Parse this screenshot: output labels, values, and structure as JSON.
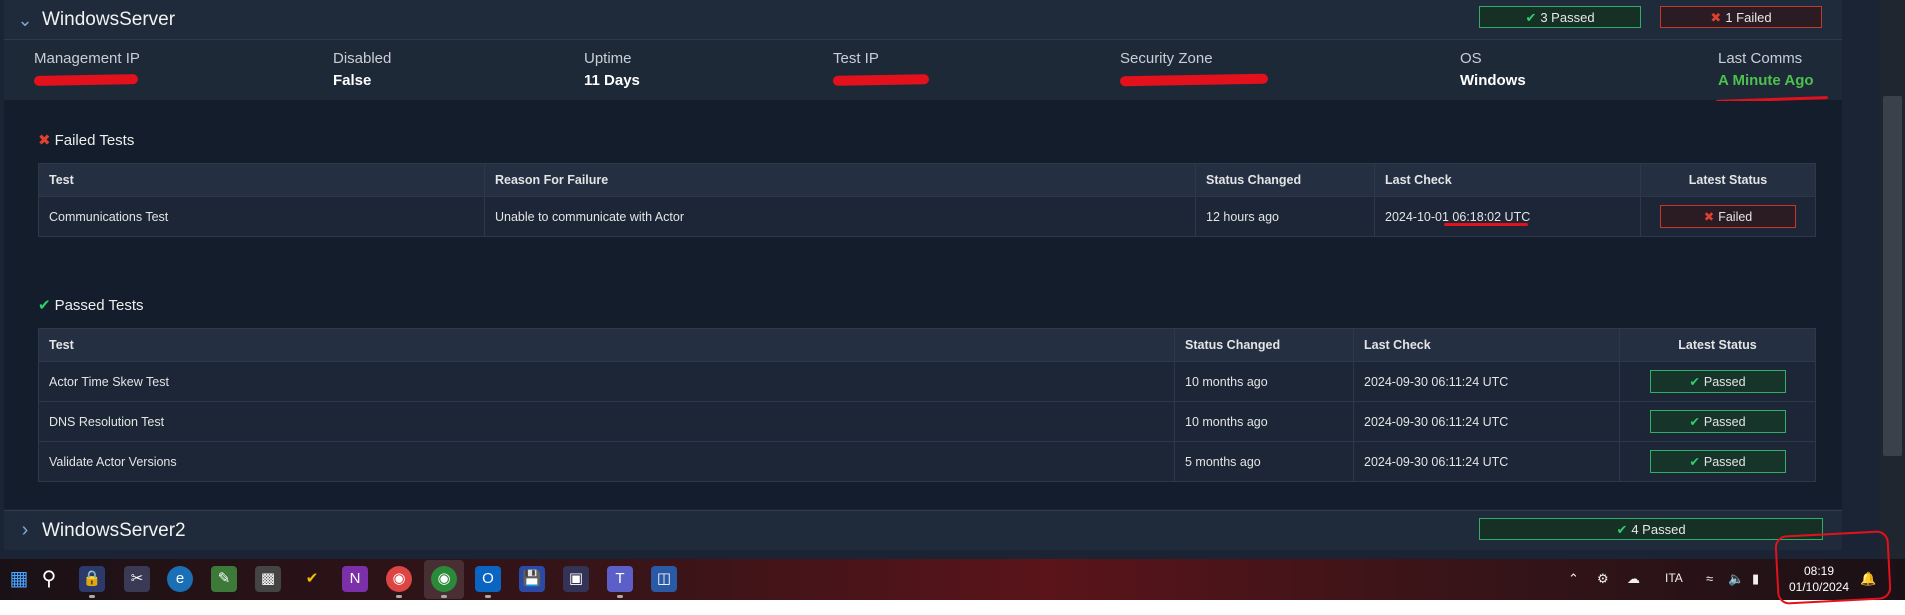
{
  "server1": {
    "name": "WindowsServer",
    "passed_badge": "3 Passed",
    "failed_badge": "1 Failed",
    "info": [
      {
        "label": "Management IP",
        "value": ""
      },
      {
        "label": "Disabled",
        "value": "False"
      },
      {
        "label": "Uptime",
        "value": "11 Days"
      },
      {
        "label": "Test IP",
        "value": ""
      },
      {
        "label": "Security Zone",
        "value": ""
      },
      {
        "label": "OS",
        "value": "Windows"
      },
      {
        "label": "Last Comms",
        "value": "A Minute Ago"
      }
    ],
    "failed_section_title": "Failed Tests",
    "failed_headers": [
      "Test",
      "Reason For Failure",
      "Status Changed",
      "Last Check",
      "Latest Status"
    ],
    "failed_rows": [
      {
        "test": "Communications Test",
        "reason": "Unable to communicate with Actor",
        "changed": "12 hours ago",
        "last_check": "2024-10-01 06:18:02 UTC",
        "status": "Failed"
      }
    ],
    "passed_section_title": "Passed Tests",
    "passed_headers": [
      "Test",
      "Status Changed",
      "Last Check",
      "Latest Status"
    ],
    "passed_rows": [
      {
        "test": "Actor Time Skew Test",
        "changed": "10 months ago",
        "last_check": "2024-09-30 06:11:24 UTC",
        "status": "Passed"
      },
      {
        "test": "DNS Resolution Test",
        "changed": "10 months ago",
        "last_check": "2024-09-30 06:11:24 UTC",
        "status": "Passed"
      },
      {
        "test": "Validate Actor Versions",
        "changed": "5 months ago",
        "last_check": "2024-09-30 06:11:24 UTC",
        "status": "Passed"
      }
    ]
  },
  "server2": {
    "name": "WindowsServer2",
    "passed_badge": "4 Passed"
  },
  "taskbar": {
    "language": "ITA",
    "time": "08:19",
    "date": "01/10/2024"
  },
  "colors": {
    "accent_green": "#2fcf6a",
    "accent_red": "#e0402f",
    "last_comms_green": "#4cc14e"
  }
}
